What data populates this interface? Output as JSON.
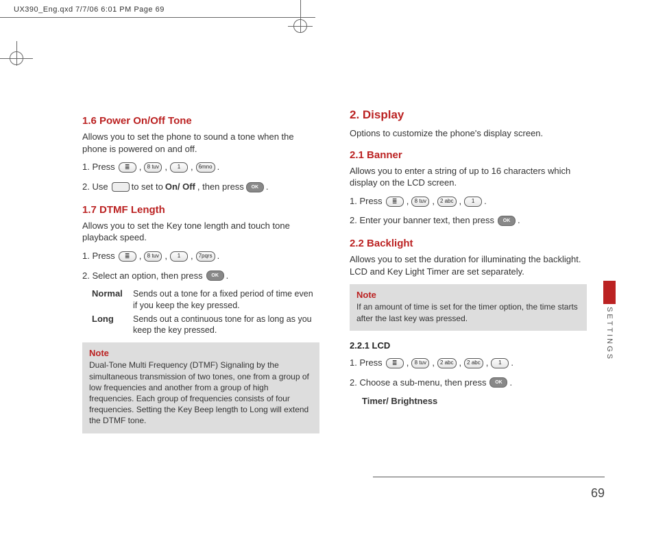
{
  "crop_header": "UX390_Eng.qxd  7/7/06  6:01 PM  Page 69",
  "left": {
    "h16": "1.6 Power On/Off Tone",
    "p16": "Allows you to set the phone to sound a tone when the phone is powered on and off.",
    "s16_1a": "1. Press",
    "k_8": "8 tuv",
    "k_1": "1",
    "k_6": "6mno",
    "k_7": "7pqrs",
    "k_2": "2 abc",
    "s16_2a": "2. Use",
    "s16_2b": "to set to",
    "onoff": "On/ Off",
    "thenpress": ", then press",
    "h17": "1.7 DTMF Length",
    "p17": "Allows you to set the Key tone length and touch tone playback speed.",
    "s17_1": "1. Press",
    "s17_2": "2. Select an option, then press",
    "d_norm_t": "Normal",
    "d_norm_d": "Sends out a tone for a fixed period of time even if you keep the key pressed.",
    "d_long_t": "Long",
    "d_long_d": "Sends out a continuous tone for as long as you keep the key pressed.",
    "note_t": "Note",
    "note_b": "Dual-Tone Multi Frequency (DTMF) Signaling by the simultaneous transmission of two tones, one from a group of low frequencies and another from a group of high frequencies. Each group of frequencies consists of four frequencies. Setting the Key Beep length to Long will extend the DTMF tone."
  },
  "right": {
    "h2": "2. Display",
    "p2": "Options to customize the phone's display screen.",
    "h21": "2.1 Banner",
    "p21": "Allows you to enter a string of up to 16 characters which display on the LCD screen.",
    "s21_1": "1. Press",
    "s21_2": "2. Enter your banner text, then press",
    "h22": "2.2 Backlight",
    "p22": "Allows you to set the duration for illuminating the backlight. LCD and Key Light Timer are set separately.",
    "note_t": "Note",
    "note_b": "If an amount of time is set for the timer option, the time starts after the last key was pressed.",
    "h221": "2.2.1 LCD",
    "s221_1": "1. Press",
    "s221_2": "2. Choose a sub-menu, then press",
    "sub221": "Timer/ Brightness"
  },
  "ok": "OK",
  "dot": ".",
  "side": "SETTINGS",
  "page": "69"
}
